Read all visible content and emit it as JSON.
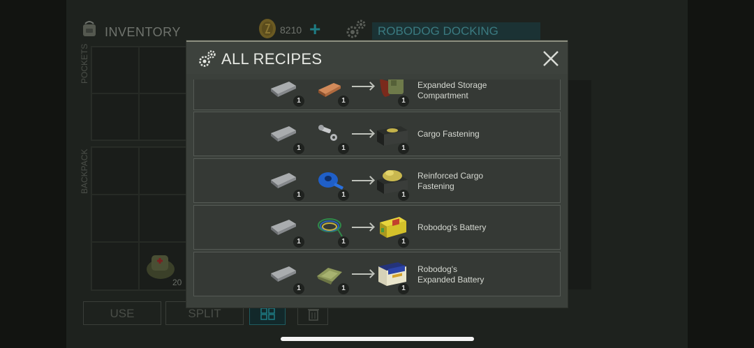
{
  "background": {
    "inventory_title": "INVENTORY",
    "coins": "8210",
    "station_title": "ROBODOG DOCKING STATION",
    "pockets_label": "POCKETS",
    "backpack_label": "BACKPACK",
    "use_button": "USE",
    "split_button": "SPLIT",
    "item_count": "20"
  },
  "dialog": {
    "title": "ALL RECIPES",
    "recipes": [
      {
        "ingredient1": "metal-plate-icon",
        "ingredient1_count": "1",
        "ingredient2": "copper-bar-icon",
        "ingredient2_count": "1",
        "result": "storage-compartment-icon",
        "result_count": "1",
        "label_line1": "Expanded Storage",
        "label_line2": "Compartment"
      },
      {
        "ingredient1": "metal-plate-icon",
        "ingredient1_count": "1",
        "ingredient2": "bolts-icon",
        "ingredient2_count": "1",
        "result": "cargo-crate-icon",
        "result_count": "1",
        "label_line1": "Cargo Fastening",
        "label_line2": ""
      },
      {
        "ingredient1": "metal-plate-icon",
        "ingredient1_count": "1",
        "ingredient2": "blue-tape-icon",
        "ingredient2_count": "1",
        "result": "cargo-crate-full-icon",
        "result_count": "1",
        "label_line1": "Reinforced Cargo",
        "label_line2": "Fastening"
      },
      {
        "ingredient1": "metal-plate-icon",
        "ingredient1_count": "1",
        "ingredient2": "wires-icon",
        "ingredient2_count": "1",
        "result": "battery-icon",
        "result_count": "1",
        "label_line1": "Robodog's Battery",
        "label_line2": ""
      },
      {
        "ingredient1": "metal-plate-icon",
        "ingredient1_count": "1",
        "ingredient2": "cloth-icon",
        "ingredient2_count": "1",
        "result": "car-battery-icon",
        "result_count": "1",
        "label_line1": "Robodog's",
        "label_line2": "Expanded Battery"
      }
    ]
  },
  "colors": {
    "dialog_bg": "#3b403b",
    "row_bg": "#353935",
    "accent_teal": "#1e7c84"
  }
}
